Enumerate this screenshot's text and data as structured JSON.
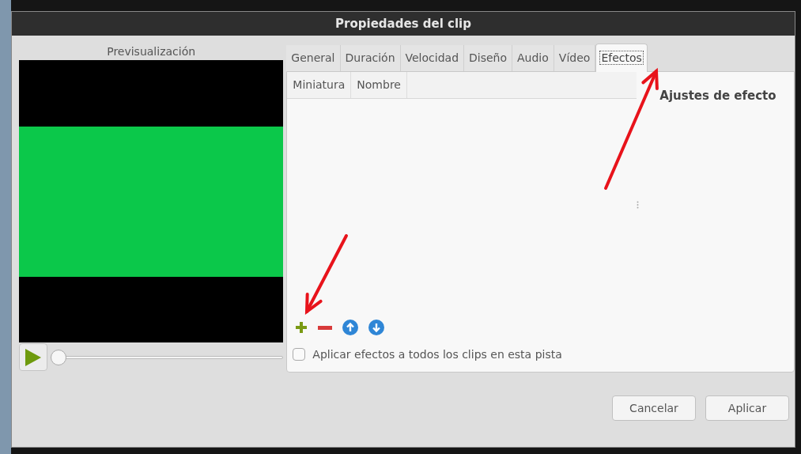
{
  "window": {
    "title": "Propiedades del clip"
  },
  "preview": {
    "label": "Previsualización",
    "playhead": {
      "level": 0
    }
  },
  "tabs": [
    {
      "label": "General",
      "selected": false
    },
    {
      "label": "Duración",
      "selected": false
    },
    {
      "label": "Velocidad",
      "selected": false
    },
    {
      "label": "Diseño",
      "selected": false
    },
    {
      "label": "Audio",
      "selected": false
    },
    {
      "label": "Vídeo",
      "selected": false
    },
    {
      "label": "Efectos",
      "selected": true
    }
  ],
  "effects_table": {
    "columns": [
      "Miniatura",
      "Nombre"
    ]
  },
  "effect_settings": {
    "title": "Ajustes de efecto"
  },
  "apply_to_all": {
    "label": "Aplicar efectos a todos los clips en esta pista",
    "checked": false
  },
  "buttons": [
    "Cancelar",
    "Aplicar"
  ]
}
